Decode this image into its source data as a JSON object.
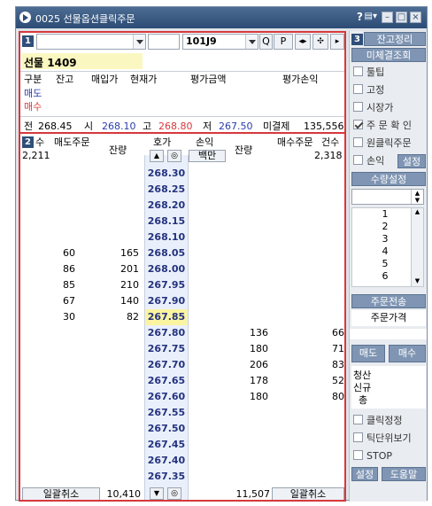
{
  "window": {
    "title": "0025 선물옵션클릭주문",
    "help": "?",
    "menu": "▤▾",
    "min": "–",
    "max": "□",
    "close": "×"
  },
  "panel1": {
    "tag": "1",
    "code_value": "101J9",
    "search_symbol": "Q",
    "p_label": "P",
    "instrument": "선물 1409",
    "headers": [
      "구분",
      "잔고",
      "매입가",
      "현재가",
      "평가금액",
      "평가손익"
    ],
    "row_sell": "매도",
    "row_buy": "매수",
    "summary": {
      "prev_label": "전",
      "prev": "268.45",
      "open_label": "시",
      "open": "268.10",
      "high_label": "고",
      "high": "268.80",
      "low_label": "저",
      "low": "267.50",
      "unsettled_label": "미결제",
      "unsettled": "135,556"
    }
  },
  "panel2": {
    "tag": "2",
    "headers": {
      "count_left": "수",
      "sell_order": "매도주문",
      "remain_left": "잔량",
      "price": "호가",
      "pnl": "손익",
      "pnl_unit": "백만",
      "remain_right": "잔량",
      "buy_order": "매수주문",
      "count_right": "건수"
    },
    "totals": {
      "sell_count": "2,211",
      "buy_count": "2,318"
    },
    "rows": [
      {
        "price": "268.30",
        "lc": "",
        "lr": "",
        "rr": "",
        "rc": ""
      },
      {
        "price": "268.25",
        "lc": "",
        "lr": "",
        "rr": "",
        "rc": ""
      },
      {
        "price": "268.20",
        "lc": "",
        "lr": "",
        "rr": "",
        "rc": ""
      },
      {
        "price": "268.15",
        "lc": "",
        "lr": "",
        "rr": "",
        "rc": ""
      },
      {
        "price": "268.10",
        "lc": "",
        "lr": "",
        "rr": "",
        "rc": ""
      },
      {
        "price": "268.05",
        "lc": "60",
        "lr": "165",
        "rr": "",
        "rc": ""
      },
      {
        "price": "268.00",
        "lc": "86",
        "lr": "201",
        "rr": "",
        "rc": ""
      },
      {
        "price": "267.95",
        "lc": "85",
        "lr": "210",
        "rr": "",
        "rc": ""
      },
      {
        "price": "267.90",
        "lc": "67",
        "lr": "140",
        "rr": "",
        "rc": ""
      },
      {
        "price": "267.85",
        "lc": "30",
        "lr": "82",
        "rr": "",
        "rc": ""
      },
      {
        "price": "267.80",
        "lc": "",
        "lr": "",
        "rr": "136",
        "rc": "66"
      },
      {
        "price": "267.75",
        "lc": "",
        "lr": "",
        "rr": "180",
        "rc": "71"
      },
      {
        "price": "267.70",
        "lc": "",
        "lr": "",
        "rr": "206",
        "rc": "83"
      },
      {
        "price": "267.65",
        "lc": "",
        "lr": "",
        "rr": "178",
        "rc": "52"
      },
      {
        "price": "267.60",
        "lc": "",
        "lr": "",
        "rr": "180",
        "rc": "80"
      },
      {
        "price": "267.55",
        "lc": "",
        "lr": "",
        "rr": "",
        "rc": ""
      },
      {
        "price": "267.50",
        "lc": "",
        "lr": "",
        "rr": "",
        "rc": ""
      },
      {
        "price": "267.45",
        "lc": "",
        "lr": "",
        "rr": "",
        "rc": ""
      },
      {
        "price": "267.40",
        "lc": "",
        "lr": "",
        "rr": "",
        "rc": ""
      },
      {
        "price": "267.35",
        "lc": "",
        "lr": "",
        "rr": "",
        "rc": ""
      }
    ],
    "footer": {
      "left_button": "일괄취소",
      "sell_remain_total": "10,410",
      "buy_remain_total": "11,507",
      "right_button": "일괄취소"
    }
  },
  "panel3": {
    "tag": "3",
    "btn_balance": "잔고정리",
    "btn_unfilled": "미체결조회",
    "chk_tooltip": "툴팁",
    "chk_fixed": "고정",
    "chk_market": "시장가",
    "chk_confirm": "주 문 확 인",
    "chk_oneclick": "원클릭주문",
    "chk_pnl": "손익",
    "btn_pnl_setup": "설정",
    "btn_qty_setup": "수량설정",
    "qty_items": [
      "1",
      "2",
      "3",
      "4",
      "5",
      "6"
    ],
    "btn_order_send": "주문전송",
    "order_price_label": "주문가격",
    "btn_sell": "매도",
    "btn_buy": "매수",
    "lbl_liquidate": "청산",
    "lbl_new": "신규",
    "lbl_total": "총",
    "chk_click_fix": "클릭정정",
    "chk_tick": "틱단위보기",
    "chk_stop": "STOP",
    "btn_setup": "설정",
    "btn_help": "도움말"
  }
}
